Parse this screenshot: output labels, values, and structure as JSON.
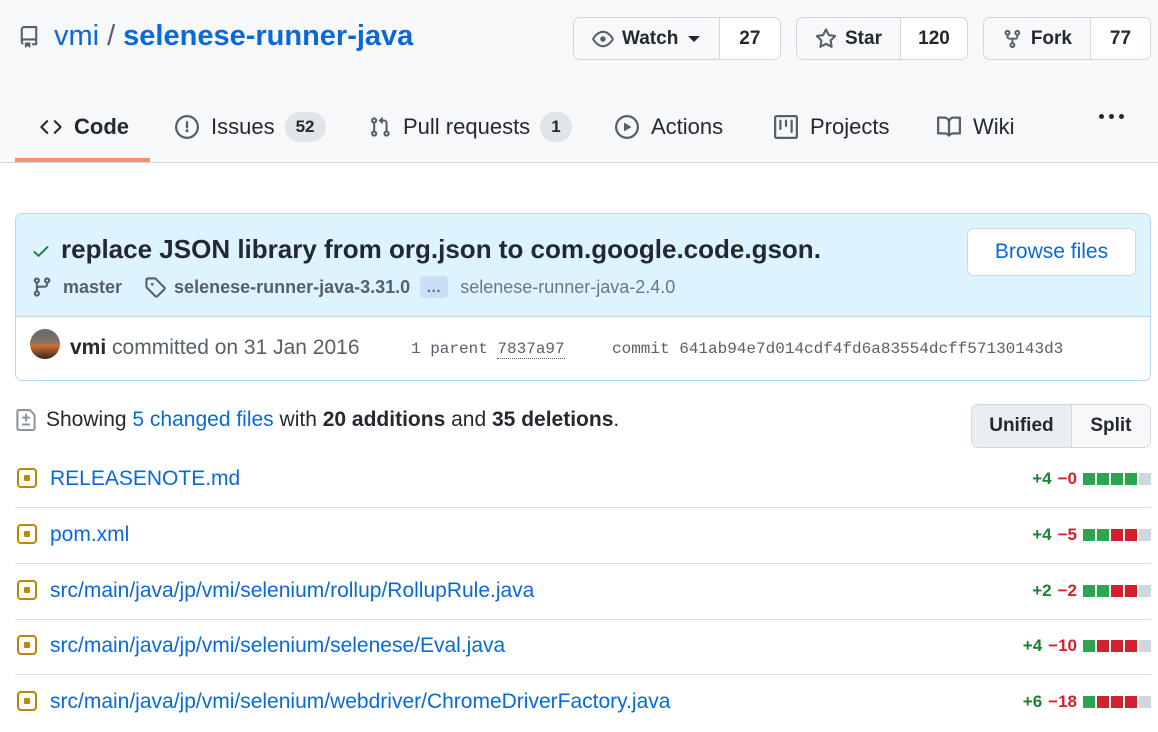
{
  "repo": {
    "owner": "vmi",
    "separator": "/",
    "name": "selenese-runner-java"
  },
  "actions": {
    "watch": {
      "label": "Watch",
      "count": "27"
    },
    "star": {
      "label": "Star",
      "count": "120"
    },
    "fork": {
      "label": "Fork",
      "count": "77"
    }
  },
  "tabs": {
    "code": {
      "label": "Code"
    },
    "issues": {
      "label": "Issues",
      "count": "52"
    },
    "pulls": {
      "label": "Pull requests",
      "count": "1"
    },
    "actions": {
      "label": "Actions"
    },
    "projects": {
      "label": "Projects"
    },
    "wiki": {
      "label": "Wiki"
    }
  },
  "commit": {
    "title": "replace JSON library from org.json to com.google.code.gson.",
    "browse_label": "Browse files",
    "branch": "master",
    "tag_first": "selenese-runner-java-3.31.0",
    "ellipsis": "…",
    "tag_last": "selenese-runner-java-2.4.0",
    "author": "vmi",
    "committed_text": "committed on 31 Jan 2016",
    "parent_label": "1 parent",
    "parent_sha": "7837a97",
    "commit_label": "commit",
    "sha": "641ab94e7d014cdf4fd6a83554dcff57130143d3"
  },
  "summary": {
    "showing": "Showing",
    "changed_files": "5 changed files",
    "with": "with",
    "additions": "20 additions",
    "and": "and",
    "deletions": "35 deletions",
    "period": "."
  },
  "view_toggle": {
    "unified": "Unified",
    "split": "Split"
  },
  "files": [
    {
      "name": "RELEASENOTE.md",
      "add": "+4",
      "del": "−0",
      "blocks": [
        "add",
        "add",
        "add",
        "add",
        "neu"
      ]
    },
    {
      "name": "pom.xml",
      "add": "+4",
      "del": "−5",
      "blocks": [
        "add",
        "add",
        "del",
        "del",
        "neu"
      ]
    },
    {
      "name": "src/main/java/jp/vmi/selenium/rollup/RollupRule.java",
      "add": "+2",
      "del": "−2",
      "blocks": [
        "add",
        "add",
        "del",
        "del",
        "neu"
      ]
    },
    {
      "name": "src/main/java/jp/vmi/selenium/selenese/Eval.java",
      "add": "+4",
      "del": "−10",
      "blocks": [
        "add",
        "del",
        "del",
        "del",
        "neu"
      ]
    },
    {
      "name": "src/main/java/jp/vmi/selenium/webdriver/ChromeDriverFactory.java",
      "add": "+6",
      "del": "−18",
      "blocks": [
        "add",
        "del",
        "del",
        "del",
        "neu"
      ]
    }
  ]
}
